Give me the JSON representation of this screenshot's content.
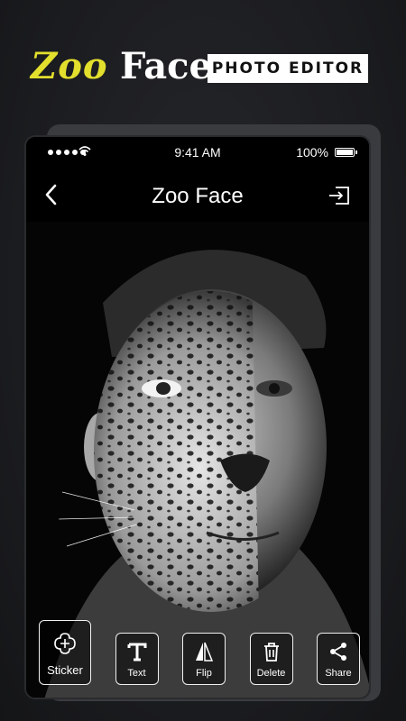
{
  "promo": {
    "brand_zoo": "Zoo",
    "brand_face": "Face",
    "tagline": "PHOTO EDITOR"
  },
  "statusbar": {
    "time": "9:41 AM",
    "battery": "100%"
  },
  "navbar": {
    "title": "Zoo Face",
    "back_icon": "chevron-left-icon",
    "exit_icon": "exit-icon"
  },
  "toolbar": {
    "tools": [
      {
        "label": "Sticker",
        "icon": "sticker-add-icon",
        "selected": true
      },
      {
        "label": "Text",
        "icon": "text-icon",
        "selected": false
      },
      {
        "label": "Flip",
        "icon": "flip-icon",
        "selected": false
      },
      {
        "label": "Delete",
        "icon": "trash-icon",
        "selected": false
      },
      {
        "label": "Share",
        "icon": "share-icon",
        "selected": false
      }
    ]
  },
  "colors": {
    "accent_yellow": "#e3df2d",
    "background": "#1a1b1e",
    "phone": "#000000"
  }
}
